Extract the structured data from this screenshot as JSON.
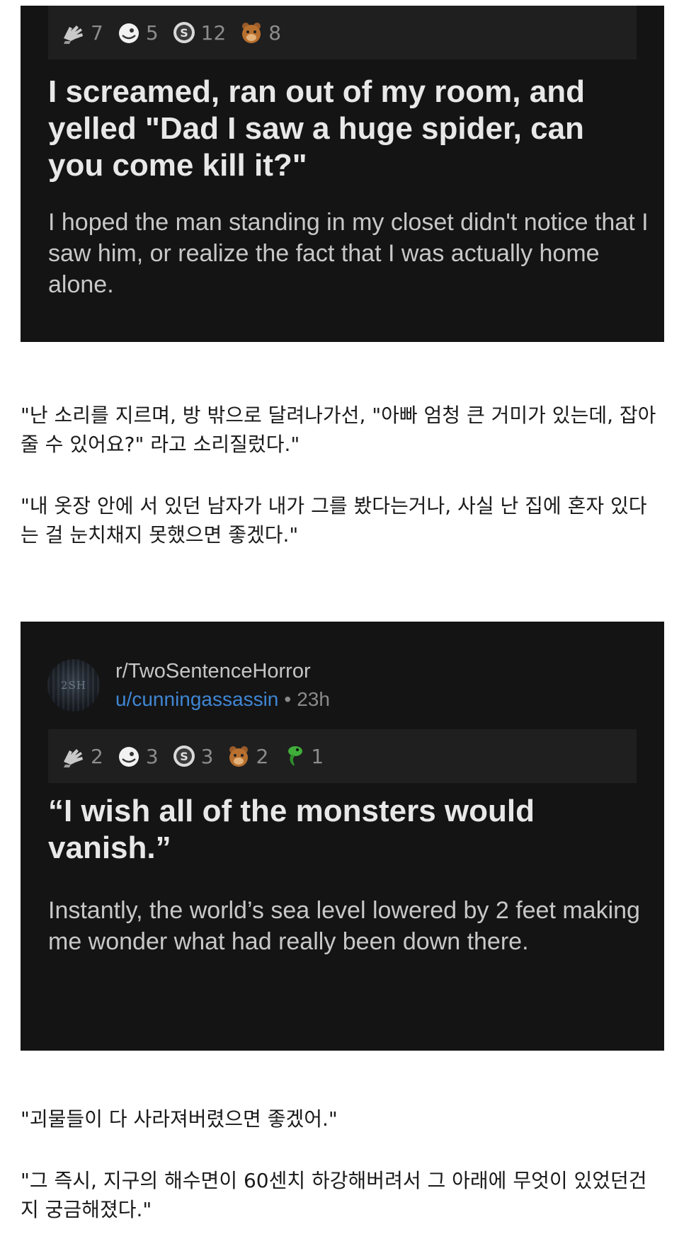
{
  "post1": {
    "awards": [
      {
        "icon": "silver-hand-award-icon",
        "count": "7"
      },
      {
        "icon": "helpful-face-award-icon",
        "count": "5"
      },
      {
        "icon": "coin-award-icon",
        "count": "12"
      },
      {
        "icon": "bear-award-icon",
        "count": "8"
      }
    ],
    "title": "I screamed, ran out of my room, and yelled \"Dad I saw a huge spider, can you come kill it?\"",
    "body": "I hoped the man standing in my closet didn't notice that I saw him, or realize the fact that I was actually home alone."
  },
  "translation1": {
    "line1": "\"난 소리를 지르며, 방 밖으로 달려나가선, \"아빠 엄청 큰 거미가 있는데, 잡아줄 수 있어요?\" 라고 소리질렀다.\"",
    "line2": "\"내 옷장 안에 서 있던 남자가 내가 그를 봤다는거나, 사실 난 집에 혼자 있다는 걸 눈치채지 못했으면 좋겠다.\""
  },
  "post2": {
    "avatar_text": "2SH",
    "subreddit": "r/TwoSentenceHorror",
    "username": "u/cunningassassin",
    "separator": "•",
    "age": "23h",
    "awards": [
      {
        "icon": "silver-hand-award-icon",
        "count": "2"
      },
      {
        "icon": "helpful-face-award-icon",
        "count": "3"
      },
      {
        "icon": "coin-award-icon",
        "count": "3"
      },
      {
        "icon": "bear-award-icon",
        "count": "2"
      },
      {
        "icon": "green-reptile-award-icon",
        "count": "1"
      }
    ],
    "title": "“I wish all of the monsters would vanish.”",
    "body": "Instantly, the world’s sea level lowered by 2 feet making me wonder what had really been down there."
  },
  "translation2": {
    "line1": "\"괴물들이 다 사라져버렸으면 좋겠어.\"",
    "line2": "\"그 즉시, 지구의 해수면이 60센치 하강해버려서 그 아래에 무엇이 있었던건지 궁금해졌다.\""
  },
  "colors": {
    "card_background": "#141414",
    "award_bar": "#1f1f1f",
    "username_link": "#3f86d4"
  }
}
